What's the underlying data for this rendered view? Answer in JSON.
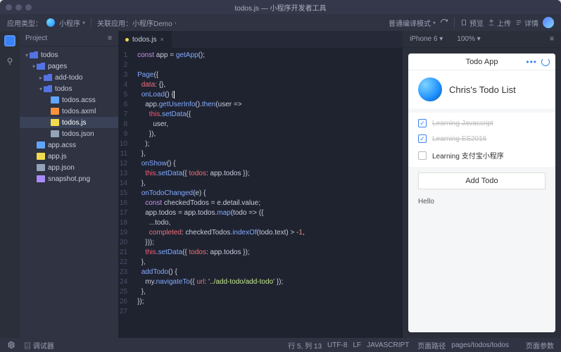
{
  "window_title": "todos.js — 小程序开发者工具",
  "toolbar": {
    "app_type_label": "应用类型：",
    "app_name": "小程序",
    "link_label": "关联应用：小程序Demo",
    "compile_mode": "普通编译模式",
    "refresh": "",
    "preview": "预览",
    "upload": "上传",
    "details": "详情"
  },
  "sidebar": {
    "title": "Project",
    "tree": [
      {
        "depth": 0,
        "icon": "folder",
        "label": "todos",
        "open": true
      },
      {
        "depth": 1,
        "icon": "folder",
        "label": "pages",
        "open": true
      },
      {
        "depth": 2,
        "icon": "folder",
        "label": "add-todo",
        "open": false
      },
      {
        "depth": 2,
        "icon": "folder",
        "label": "todos",
        "open": true
      },
      {
        "depth": 3,
        "icon": "file-css",
        "label": "todos.acss"
      },
      {
        "depth": 3,
        "icon": "file-xml",
        "label": "todos.axml"
      },
      {
        "depth": 3,
        "icon": "file-js",
        "label": "todos.js",
        "selected": true
      },
      {
        "depth": 3,
        "icon": "file-json",
        "label": "todos.json"
      },
      {
        "depth": 1,
        "icon": "file-css",
        "label": "app.acss"
      },
      {
        "depth": 1,
        "icon": "file-js",
        "label": "app.js"
      },
      {
        "depth": 1,
        "icon": "file-json",
        "label": "app.json"
      },
      {
        "depth": 1,
        "icon": "file-img",
        "label": "snapshot.png"
      }
    ]
  },
  "editor": {
    "tab_label": "todos.js",
    "line_count": 27,
    "lines_html": [
      "<span class='kw'>const</span> app = <span class='fn'>getApp</span>();",
      "",
      "<span class='fn'>Page</span>({",
      "  <span class='prop'>data</span>: {},",
      "  <span class='fn'>onLoad</span>() {<span class='cursor'></span>",
      "    app.<span class='fn'>getUserInfo</span>().<span class='fn'>then</span>(user =>",
      "      <span class='this'>this</span>.<span class='fn'>setData</span>({",
      "        user,",
      "      }),",
      "    );",
      "  },",
      "  <span class='fn'>onShow</span>() {",
      "    <span class='this'>this</span>.<span class='fn'>setData</span>({ <span class='prop'>todos</span>: app.todos });",
      "  },",
      "  <span class='fn'>onTodoChanged</span>(e) {",
      "    <span class='kw'>const</span> checkedTodos = e.detail.value;",
      "    app.todos = app.todos.<span class='fn'>map</span>(todo => ({",
      "      ...todo,",
      "      <span class='prop'>completed</span>: checkedTodos.<span class='fn'>indexOf</span>(todo.text) > -<span class='num'>1</span>,",
      "    }));",
      "    <span class='this'>this</span>.<span class='fn'>setData</span>({ <span class='prop'>todos</span>: app.todos });",
      "  },",
      "  <span class='fn'>addTodo</span>() {",
      "    my.<span class='fn'>navigateTo</span>({ <span class='prop'>url</span>: <span class='str'>'../add-todo/add-todo'</span> });",
      "  },",
      "});",
      ""
    ]
  },
  "preview": {
    "device": "iPhone 6",
    "zoom": "100%",
    "app_title": "Todo App",
    "list_title": "Chris's Todo List",
    "todos": [
      {
        "text": "Learning Javascript",
        "done": true
      },
      {
        "text": "Learning ES2016",
        "done": true
      },
      {
        "text": "Learning 支付宝小程序",
        "done": false
      }
    ],
    "add_label": "Add Todo",
    "hello": "Hello"
  },
  "statusbar": {
    "debugger": "调试器",
    "cursor": "行 5, 列 13",
    "encoding": "UTF-8",
    "eol": "LF",
    "lang": "JAVASCRIPT",
    "page_path_label": "页面路径",
    "page_path": "pages/todos/todos",
    "page_params": "页面参数"
  }
}
